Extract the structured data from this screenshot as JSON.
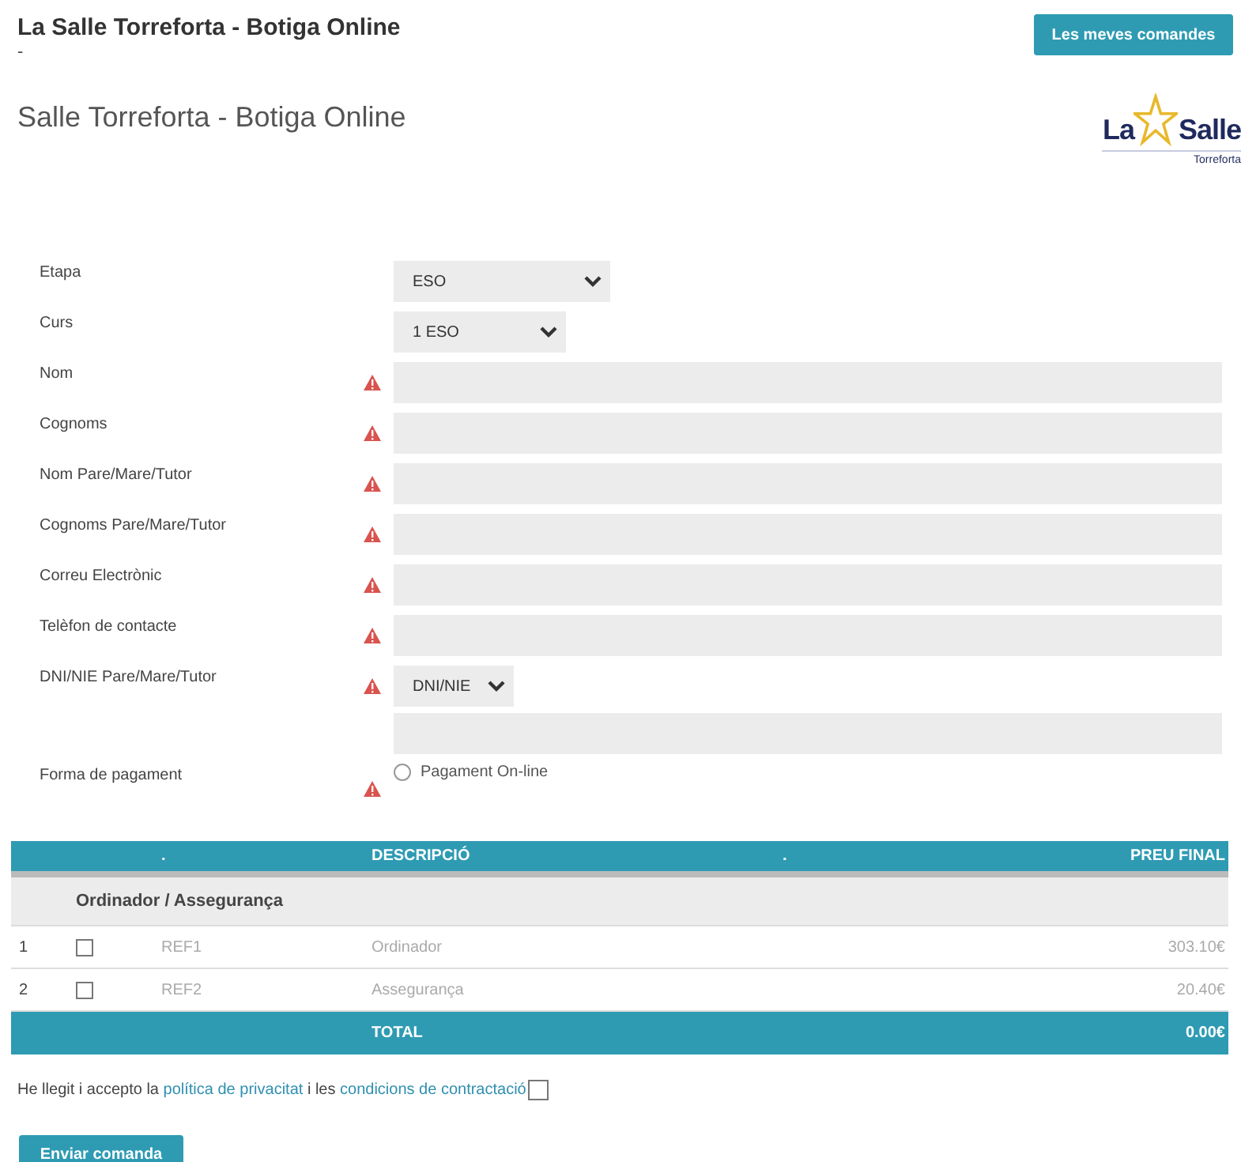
{
  "header": {
    "title": "La Salle Torreforta - Botiga Online",
    "subtitle": "-",
    "orders_button": "Les meves comandes"
  },
  "page_title": "Salle Torreforta - Botiga Online",
  "logo": {
    "left": "La",
    "right": "Salle",
    "caption": "Torreforta"
  },
  "form": [
    {
      "label": "Etapa",
      "kind": "select",
      "required": false,
      "value": "ESO"
    },
    {
      "label": "Curs",
      "kind": "select",
      "required": false,
      "value": "1 ESO"
    },
    {
      "label": "Nom",
      "kind": "text",
      "required": true
    },
    {
      "label": "Cognoms",
      "kind": "text",
      "required": true
    },
    {
      "label": "Nom Pare/Mare/Tutor",
      "kind": "text",
      "required": true
    },
    {
      "label": "Cognoms Pare/Mare/Tutor",
      "kind": "text",
      "required": true
    },
    {
      "label": "Correu Electrònic",
      "kind": "text",
      "required": true
    },
    {
      "label": "Telèfon de contacte",
      "kind": "text",
      "required": true
    },
    {
      "label": "DNI/NIE Pare/Mare/Tutor",
      "kind": "select_text",
      "required": true,
      "value": "DNI/NIE"
    },
    {
      "label": "Forma de pagament",
      "kind": "radio",
      "required": true,
      "option": "Pagament On-line",
      "selected": false
    }
  ],
  "table": {
    "columns": [
      ".",
      "DESCRIPCIÓ",
      ".",
      "PREU FINAL"
    ],
    "group": "Ordinador / Assegurança",
    "rows": [
      {
        "number": "1",
        "checked": false,
        "ref": "REF1",
        "description": "Ordinador",
        "price": "303.10€"
      },
      {
        "number": "2",
        "checked": false,
        "ref": "REF2",
        "description": "Assegurança",
        "price": "20.40€"
      }
    ],
    "total_label": "TOTAL",
    "total": "0.00€"
  },
  "agreement": {
    "parts": [
      {
        "kind": "text",
        "text": "He llegit i accepto la "
      },
      {
        "kind": "link",
        "text": "política de privacitat"
      },
      {
        "kind": "text",
        "text": " i les "
      },
      {
        "kind": "link",
        "text": "condicions de contractació"
      }
    ],
    "checked": false
  },
  "submit_button": "Enviar comanda"
}
